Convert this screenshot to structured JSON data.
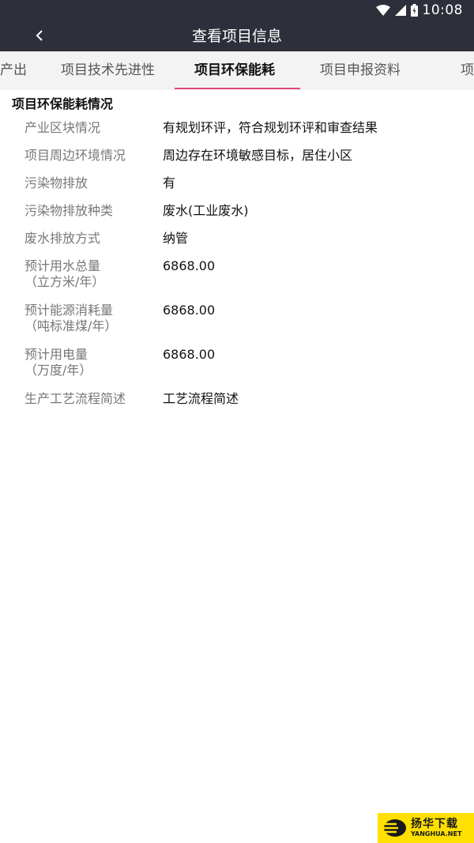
{
  "status_bar": {
    "time": "10:08",
    "icons": [
      "wifi-icon",
      "signal-icon",
      "battery-icon"
    ]
  },
  "app_bar": {
    "title": "查看项目信息",
    "back_icon": "chevron-left-icon"
  },
  "tabs": [
    {
      "label": "产出",
      "active": false
    },
    {
      "label": "项目技术先进性",
      "active": false
    },
    {
      "label": "项目环保能耗",
      "active": true
    },
    {
      "label": "项目申报资料",
      "active": false
    },
    {
      "label": "项",
      "active": false
    }
  ],
  "section": {
    "title": "项目环保能耗情况",
    "rows": [
      {
        "label": "产业区块情况",
        "value": "有规划环评，符合规划环评和审查结果"
      },
      {
        "label": "项目周边环境情况",
        "value": "周边存在环境敏感目标，居住小区"
      },
      {
        "label": "污染物排放",
        "value": "有"
      },
      {
        "label": "污染物排放种类",
        "value": "废水(工业废水)"
      },
      {
        "label": "废水排放方式",
        "value": "纳管"
      },
      {
        "label": "预计用水总量\n（立方米/年）",
        "value": "6868.00"
      },
      {
        "label": "预计能源消耗量\n（吨标准煤/年）",
        "value": "6868.00"
      },
      {
        "label": "预计用电量\n（万度/年）",
        "value": "6868.00"
      },
      {
        "label": "生产工艺流程简述",
        "value": "工艺流程简述"
      }
    ]
  },
  "watermark": {
    "name": "扬华下载",
    "url_text": "YANGHUA.NET"
  },
  "colors": {
    "header_bg": "#2d2f3a",
    "tab_bar_bg": "#f3f3f3",
    "tab_indicator": "#e0487b",
    "label_text": "#777777",
    "value_text": "#111111",
    "watermark_bg": "#ffe000"
  }
}
